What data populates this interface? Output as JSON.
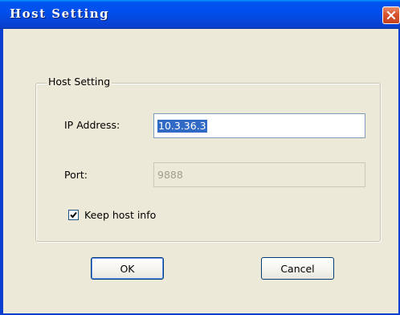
{
  "window": {
    "title": "Host Setting"
  },
  "group": {
    "legend": "Host Setting"
  },
  "fields": {
    "ip_label": "IP Address:",
    "ip_value": "10.3.36.3",
    "port_label": "Port:",
    "port_value": "9888"
  },
  "options": {
    "keep_host_info_label": "Keep host info",
    "keep_host_info_checked": true
  },
  "buttons": {
    "ok_label": "OK",
    "cancel_label": "Cancel"
  },
  "colors": {
    "titlebar": "#0053ee",
    "close_button": "#d8532f",
    "dialog_background": "#ece9d8",
    "selection": "#316ac5"
  },
  "icons": {
    "close": "close-icon",
    "check": "checkmark-icon"
  }
}
